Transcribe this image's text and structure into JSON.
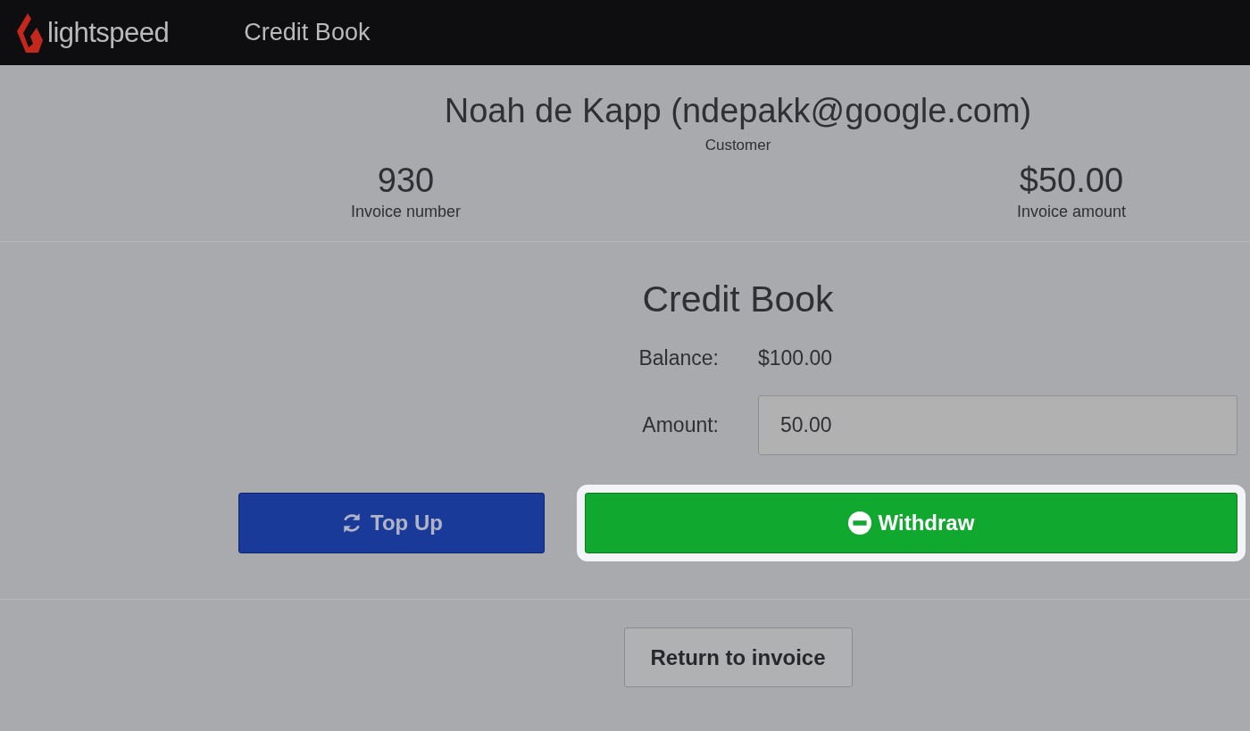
{
  "header": {
    "brand": "lightspeed",
    "title": "Credit Book"
  },
  "customer": {
    "name": "Noah de Kapp (ndepakk@google.com)",
    "caption": "Customer"
  },
  "stats": [
    {
      "value": "930",
      "label": "Invoice number"
    },
    {
      "value": "$50.00",
      "label": "Invoice amount"
    }
  ],
  "credit_book": {
    "title": "Credit Book",
    "balance_label": "Balance:",
    "balance": "$100.00",
    "amount_label": "Amount:",
    "amount": "50.00"
  },
  "actions": [
    {
      "kind": "top_up",
      "label": "Top Up",
      "highlighted": false
    },
    {
      "kind": "withdraw",
      "label": "Withdraw",
      "highlighted": true
    }
  ],
  "return_button": {
    "label": "Return to invoice"
  }
}
